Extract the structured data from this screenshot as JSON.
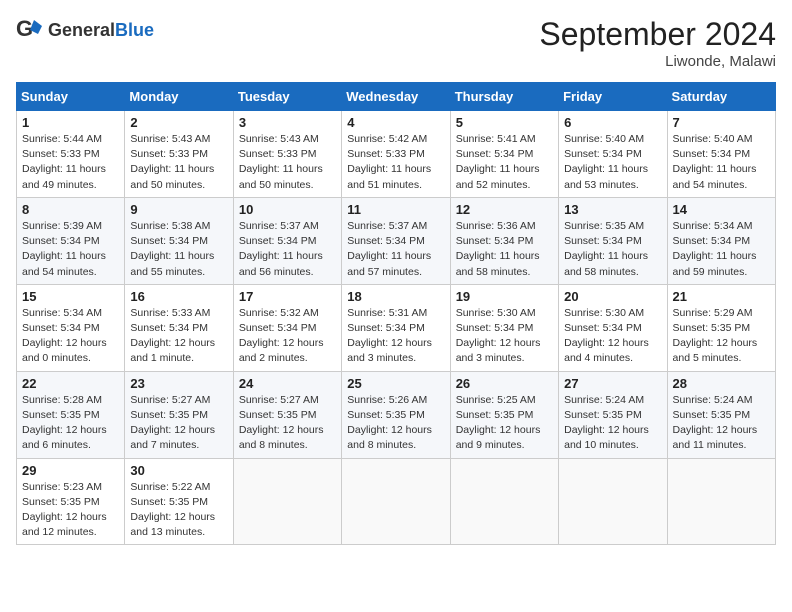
{
  "header": {
    "logo_general": "General",
    "logo_blue": "Blue",
    "month_title": "September 2024",
    "location": "Liwonde, Malawi"
  },
  "weekdays": [
    "Sunday",
    "Monday",
    "Tuesday",
    "Wednesday",
    "Thursday",
    "Friday",
    "Saturday"
  ],
  "weeks": [
    [
      {
        "day": "1",
        "info": "Sunrise: 5:44 AM\nSunset: 5:33 PM\nDaylight: 11 hours\nand 49 minutes."
      },
      {
        "day": "2",
        "info": "Sunrise: 5:43 AM\nSunset: 5:33 PM\nDaylight: 11 hours\nand 50 minutes."
      },
      {
        "day": "3",
        "info": "Sunrise: 5:43 AM\nSunset: 5:33 PM\nDaylight: 11 hours\nand 50 minutes."
      },
      {
        "day": "4",
        "info": "Sunrise: 5:42 AM\nSunset: 5:33 PM\nDaylight: 11 hours\nand 51 minutes."
      },
      {
        "day": "5",
        "info": "Sunrise: 5:41 AM\nSunset: 5:34 PM\nDaylight: 11 hours\nand 52 minutes."
      },
      {
        "day": "6",
        "info": "Sunrise: 5:40 AM\nSunset: 5:34 PM\nDaylight: 11 hours\nand 53 minutes."
      },
      {
        "day": "7",
        "info": "Sunrise: 5:40 AM\nSunset: 5:34 PM\nDaylight: 11 hours\nand 54 minutes."
      }
    ],
    [
      {
        "day": "8",
        "info": "Sunrise: 5:39 AM\nSunset: 5:34 PM\nDaylight: 11 hours\nand 54 minutes."
      },
      {
        "day": "9",
        "info": "Sunrise: 5:38 AM\nSunset: 5:34 PM\nDaylight: 11 hours\nand 55 minutes."
      },
      {
        "day": "10",
        "info": "Sunrise: 5:37 AM\nSunset: 5:34 PM\nDaylight: 11 hours\nand 56 minutes."
      },
      {
        "day": "11",
        "info": "Sunrise: 5:37 AM\nSunset: 5:34 PM\nDaylight: 11 hours\nand 57 minutes."
      },
      {
        "day": "12",
        "info": "Sunrise: 5:36 AM\nSunset: 5:34 PM\nDaylight: 11 hours\nand 58 minutes."
      },
      {
        "day": "13",
        "info": "Sunrise: 5:35 AM\nSunset: 5:34 PM\nDaylight: 11 hours\nand 58 minutes."
      },
      {
        "day": "14",
        "info": "Sunrise: 5:34 AM\nSunset: 5:34 PM\nDaylight: 11 hours\nand 59 minutes."
      }
    ],
    [
      {
        "day": "15",
        "info": "Sunrise: 5:34 AM\nSunset: 5:34 PM\nDaylight: 12 hours\nand 0 minutes."
      },
      {
        "day": "16",
        "info": "Sunrise: 5:33 AM\nSunset: 5:34 PM\nDaylight: 12 hours\nand 1 minute."
      },
      {
        "day": "17",
        "info": "Sunrise: 5:32 AM\nSunset: 5:34 PM\nDaylight: 12 hours\nand 2 minutes."
      },
      {
        "day": "18",
        "info": "Sunrise: 5:31 AM\nSunset: 5:34 PM\nDaylight: 12 hours\nand 3 minutes."
      },
      {
        "day": "19",
        "info": "Sunrise: 5:30 AM\nSunset: 5:34 PM\nDaylight: 12 hours\nand 3 minutes."
      },
      {
        "day": "20",
        "info": "Sunrise: 5:30 AM\nSunset: 5:34 PM\nDaylight: 12 hours\nand 4 minutes."
      },
      {
        "day": "21",
        "info": "Sunrise: 5:29 AM\nSunset: 5:35 PM\nDaylight: 12 hours\nand 5 minutes."
      }
    ],
    [
      {
        "day": "22",
        "info": "Sunrise: 5:28 AM\nSunset: 5:35 PM\nDaylight: 12 hours\nand 6 minutes."
      },
      {
        "day": "23",
        "info": "Sunrise: 5:27 AM\nSunset: 5:35 PM\nDaylight: 12 hours\nand 7 minutes."
      },
      {
        "day": "24",
        "info": "Sunrise: 5:27 AM\nSunset: 5:35 PM\nDaylight: 12 hours\nand 8 minutes."
      },
      {
        "day": "25",
        "info": "Sunrise: 5:26 AM\nSunset: 5:35 PM\nDaylight: 12 hours\nand 8 minutes."
      },
      {
        "day": "26",
        "info": "Sunrise: 5:25 AM\nSunset: 5:35 PM\nDaylight: 12 hours\nand 9 minutes."
      },
      {
        "day": "27",
        "info": "Sunrise: 5:24 AM\nSunset: 5:35 PM\nDaylight: 12 hours\nand 10 minutes."
      },
      {
        "day": "28",
        "info": "Sunrise: 5:24 AM\nSunset: 5:35 PM\nDaylight: 12 hours\nand 11 minutes."
      }
    ],
    [
      {
        "day": "29",
        "info": "Sunrise: 5:23 AM\nSunset: 5:35 PM\nDaylight: 12 hours\nand 12 minutes."
      },
      {
        "day": "30",
        "info": "Sunrise: 5:22 AM\nSunset: 5:35 PM\nDaylight: 12 hours\nand 13 minutes."
      },
      {
        "day": "",
        "info": ""
      },
      {
        "day": "",
        "info": ""
      },
      {
        "day": "",
        "info": ""
      },
      {
        "day": "",
        "info": ""
      },
      {
        "day": "",
        "info": ""
      }
    ]
  ]
}
